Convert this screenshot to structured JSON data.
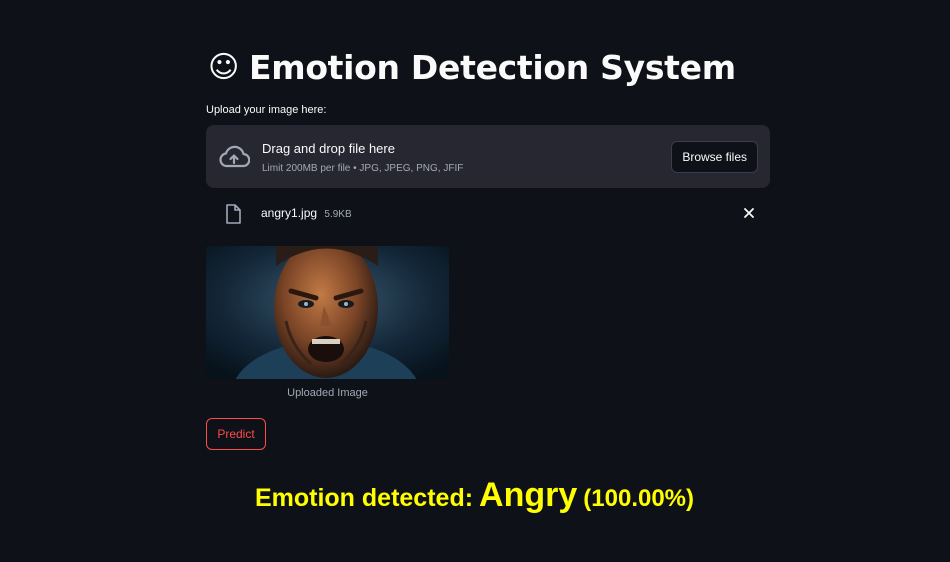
{
  "page": {
    "title_icon": "smiley-face-icon",
    "title_glyph": "☺",
    "title": "Emotion Detection System"
  },
  "uploader": {
    "label": "Upload your image here:",
    "drop_text": "Drag and drop file here",
    "limit_text": "Limit 200MB per file • JPG, JPEG, PNG, JFIF",
    "browse_label": "Browse files",
    "icon": "cloud-upload-icon"
  },
  "file": {
    "name": "angry1.jpg",
    "size": "5.9KB",
    "icon": "file-icon",
    "remove_icon": "close-icon"
  },
  "image": {
    "caption": "Uploaded Image"
  },
  "actions": {
    "predict_label": "Predict"
  },
  "result": {
    "label": "Emotion detected:",
    "emotion": "Angry",
    "confidence": "(100.00%)"
  },
  "colors": {
    "background": "#0e1117",
    "panel": "#262730",
    "accent": "#ff4b4b",
    "result_text": "#ffff00"
  }
}
